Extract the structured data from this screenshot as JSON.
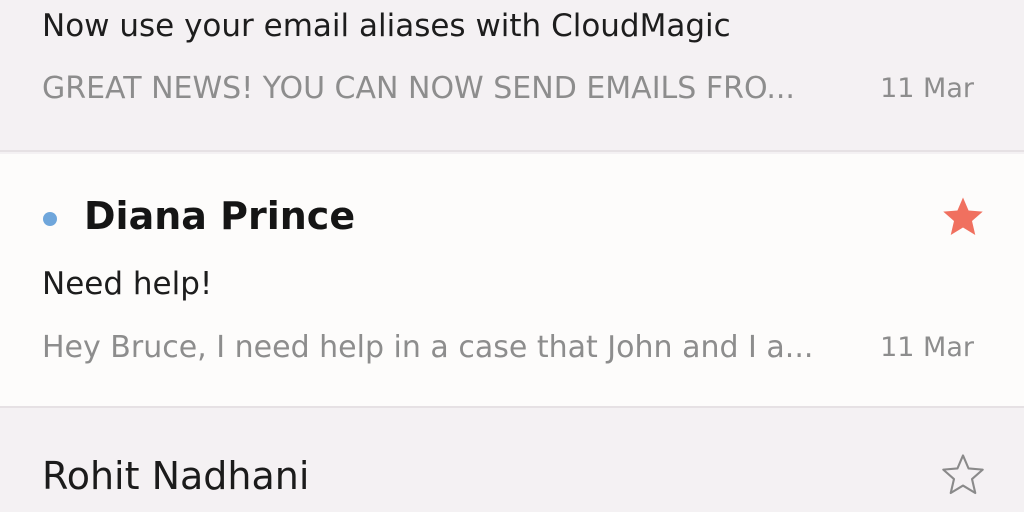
{
  "messages": [
    {
      "subject": "Now use your email aliases with CloudMagic",
      "preview": "GREAT NEWS! YOU CAN NOW SEND EMAILS FRO...",
      "date": "11 Mar"
    },
    {
      "sender": "Diana Prince",
      "unread": true,
      "starred": true,
      "subject": "Need help!",
      "preview": "Hey Bruce, I need help in a case that John and I a...",
      "date": "11 Mar"
    },
    {
      "sender": "Rohit Nadhani",
      "starred": false
    }
  ],
  "colors": {
    "unread_dot": "#6fa6db",
    "star_filled": "#f0705f",
    "star_outline": "#8a8a8a"
  },
  "icons": {
    "unread": "unread-dot-icon",
    "starred": "star-filled-icon",
    "unstarred": "star-outline-icon"
  }
}
